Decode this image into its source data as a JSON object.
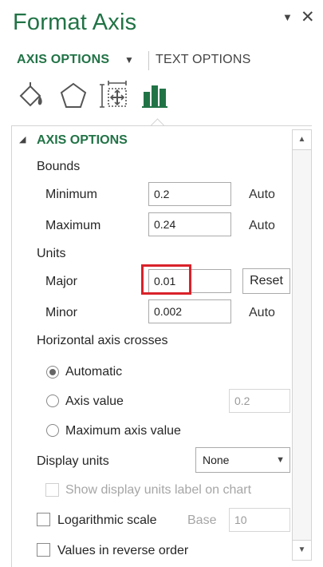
{
  "pane": {
    "title": "Format Axis",
    "menu_glyph": "▼",
    "close_glyph": "✕"
  },
  "tabs": {
    "axis_options": "AXIS OPTIONS",
    "axis_caret": "▼",
    "text_options": "TEXT OPTIONS"
  },
  "icons": [
    "fill-line-icon",
    "effects-icon",
    "size-properties-icon",
    "axis-options-icon"
  ],
  "colors": {
    "accent": "#217346",
    "highlight": "#d9222a"
  },
  "section": {
    "caret": "◢",
    "title": "AXIS OPTIONS"
  },
  "bounds": {
    "heading": "Bounds",
    "minimum_label": "Minimum",
    "minimum_value": "0.2",
    "minimum_status": "Auto",
    "maximum_label": "Maximum",
    "maximum_value": "0.24",
    "maximum_status": "Auto"
  },
  "units": {
    "heading": "Units",
    "major_label": "Major",
    "major_value": "0.01",
    "reset_label": "Reset",
    "minor_label": "Minor",
    "minor_value": "0.002",
    "minor_status": "Auto"
  },
  "crosses": {
    "heading": "Horizontal axis crosses",
    "automatic_label": "Automatic",
    "axis_value_label": "Axis value",
    "axis_value_input": "0.2",
    "maximum_label": "Maximum axis value",
    "selected": "Automatic"
  },
  "display_units": {
    "label": "Display units",
    "selected": "None",
    "show_label": "Show display units label on chart"
  },
  "logarithmic": {
    "label": "Logarithmic scale",
    "base_label": "Base",
    "base_value": "10",
    "checked": false
  },
  "reverse": {
    "label": "Values in reverse order",
    "checked": false
  },
  "scroll": {
    "up": "▲",
    "down": "▼"
  }
}
